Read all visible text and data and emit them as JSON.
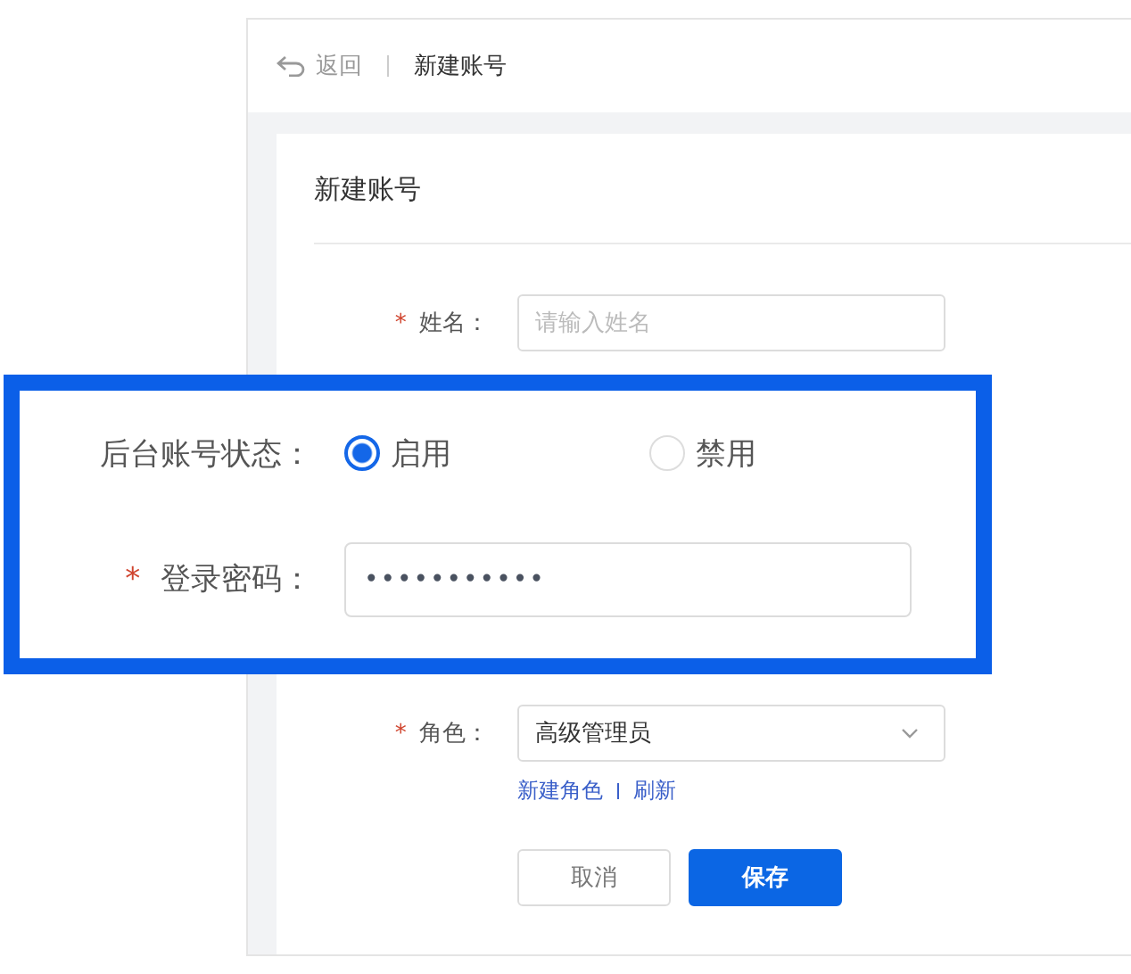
{
  "header": {
    "back": "返回",
    "title": "新建账号"
  },
  "card": {
    "title": "新建账号"
  },
  "name_field": {
    "asterisk": "*",
    "label": "姓名：",
    "placeholder": "请输入姓名"
  },
  "role_field": {
    "asterisk": "*",
    "label": "角色：",
    "value": "高级管理员",
    "links": [
      "新建角色",
      "刷新"
    ]
  },
  "buttons": [
    {
      "label": "取消",
      "kind": "default"
    },
    {
      "label": "保存",
      "kind": "primary"
    }
  ],
  "callout": {
    "status": {
      "label": "后台账号状态：",
      "options": [
        {
          "label": "启用",
          "selected": true
        },
        {
          "label": "禁用",
          "selected": false
        }
      ]
    },
    "password": {
      "asterisk": "*",
      "label": "登录密码：",
      "value": "•••••••••••"
    }
  }
}
